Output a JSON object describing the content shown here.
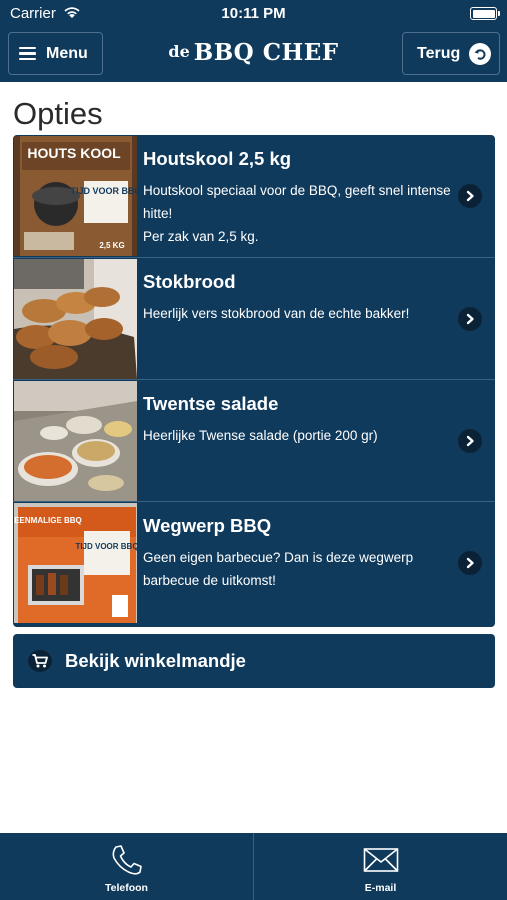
{
  "status_bar": {
    "carrier": "Carrier",
    "time": "10:11 PM"
  },
  "navbar": {
    "menu_label": "Menu",
    "logo_prefix": "de",
    "logo_main": "BBQ CHEF",
    "back_label": "Terug"
  },
  "page": {
    "title": "Opties"
  },
  "options": [
    {
      "title": "Houtskool 2,5 kg",
      "description": "Houtskool speciaal voor de BBQ, geeft snel intense hitte!\nPer zak van 2,5 kg.",
      "package_brand": "HOUTS KOOL",
      "package_slogan": "TIJD VOOR BBQ",
      "package_weight": "2,5 KG"
    },
    {
      "title": "Stokbrood",
      "description": "Heerlijk vers stokbrood van de echte bakker!"
    },
    {
      "title": "Twentse salade",
      "description": "Heerlijke Twense salade (portie 200 gr)"
    },
    {
      "title": "Wegwerp BBQ",
      "description": "Geen eigen barbecue? Dan is deze wegwerp barbecue de uitkomst!",
      "package_brand": "EENMALIGE BBQ",
      "package_slogan": "TIJD VOOR BBQ"
    }
  ],
  "cart": {
    "label": "Bekijk winkelmandje"
  },
  "tabbar": [
    {
      "label": "Telefoon",
      "icon": "phone-icon"
    },
    {
      "label": "E-mail",
      "icon": "mail-icon"
    }
  ],
  "colors": {
    "primary": "#0f3a5c",
    "dark": "#0b2236",
    "divider": "#3c6080"
  }
}
